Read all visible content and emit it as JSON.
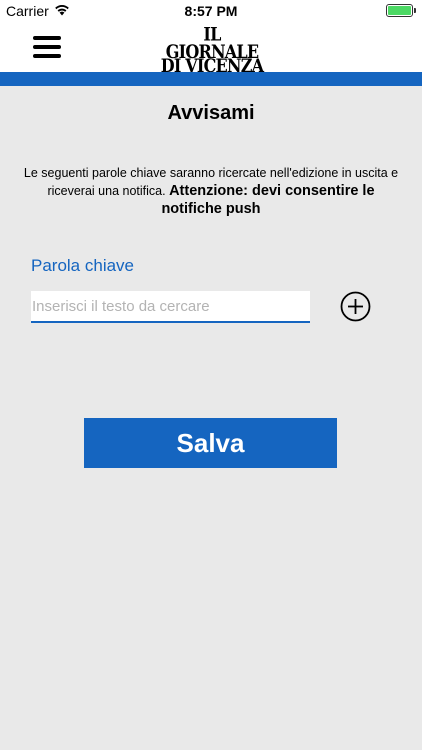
{
  "status_bar": {
    "carrier": "Carrier",
    "time": "8:57 PM",
    "battery_color": "#4cd964"
  },
  "header": {
    "menu_icon": "hamburger-menu-icon",
    "logo_line1": "IL GIORNALE",
    "logo_line2": "DI VICENZA",
    "accent_color": "#1565c0"
  },
  "main": {
    "title": "Avvisami",
    "description": "Le seguenti parole chiave saranno ricercate nell'edizione in uscita e riceverai una notifica.",
    "warning": "Attenzione: devi consentire le notifiche push",
    "keyword_label": "Parola chiave",
    "keyword_placeholder": "Inserisci il testo da cercare",
    "keyword_value": "",
    "add_icon": "plus-circle-icon",
    "save_label": "Salva"
  }
}
